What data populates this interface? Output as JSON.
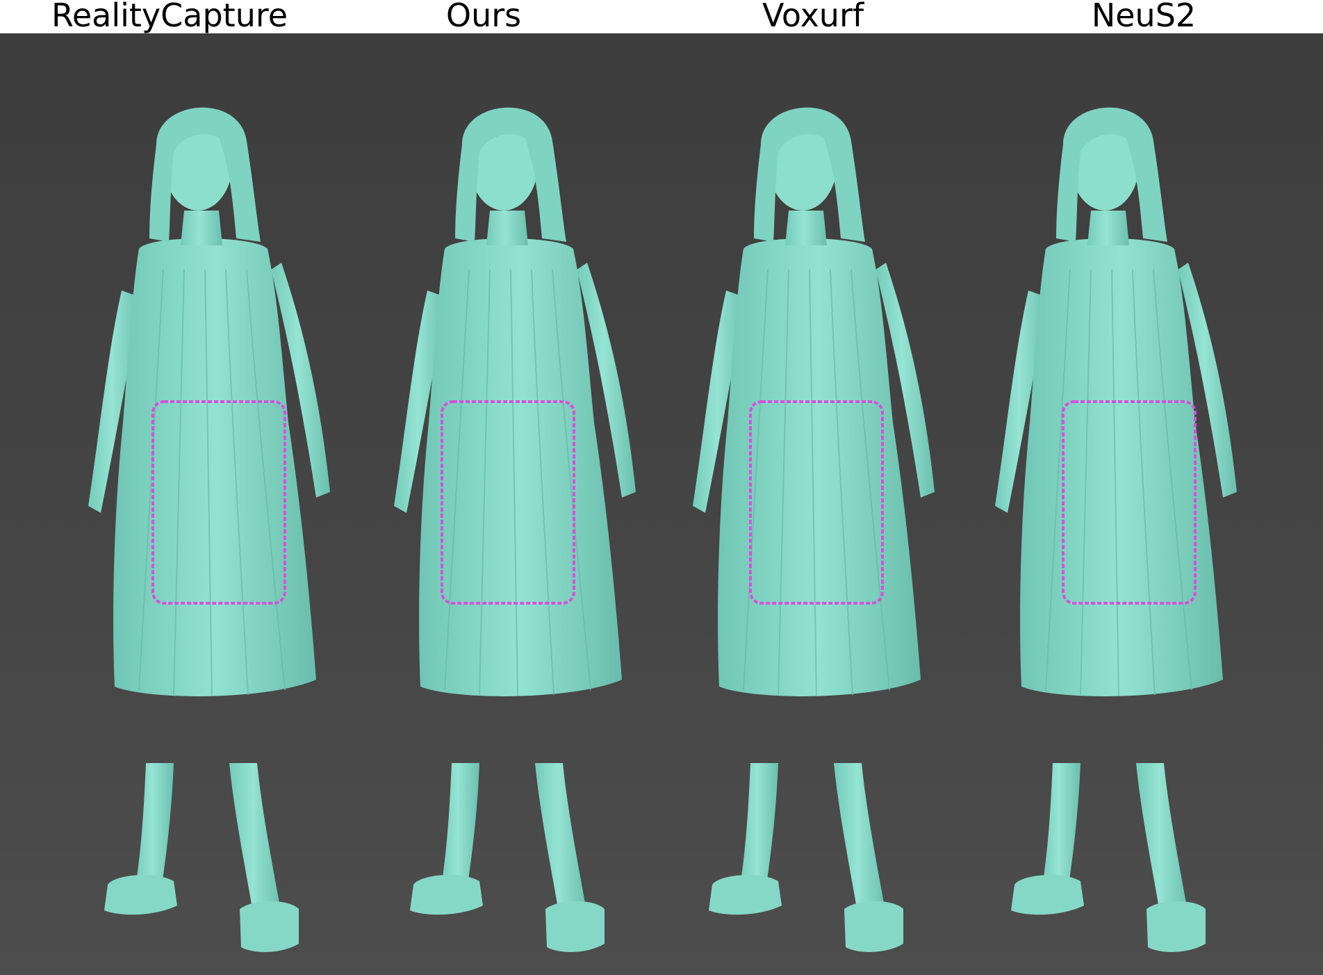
{
  "columns": [
    {
      "title": "RealityCapture"
    },
    {
      "title": "Ours"
    },
    {
      "title": "Voxurf"
    },
    {
      "title": "NeuS2"
    }
  ],
  "colors": {
    "background": "#444444",
    "mesh": "#8fe0cf",
    "mesh_shadow": "#6fc4b2",
    "highlight_box": "#d94fe0"
  }
}
